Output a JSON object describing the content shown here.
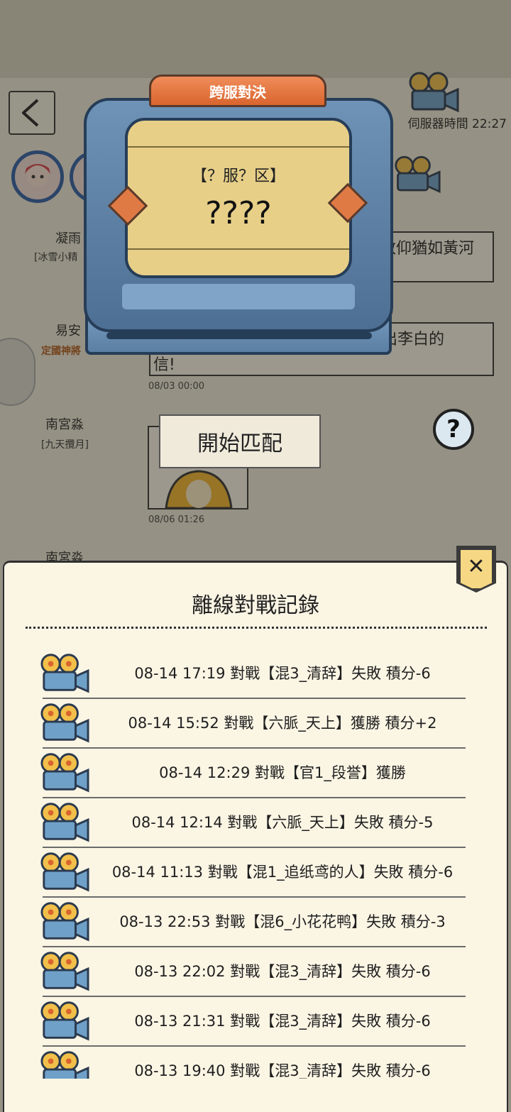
{
  "colors": {
    "accent_orange": "#d9652e",
    "tv_blue": "#4d6f93",
    "screen_yellow": "#e7cf88",
    "modal_bg": "#fbf5e4",
    "close_yellow": "#f6d884"
  },
  "header": {
    "server_time": "伺服器時間 22:27"
  },
  "background_chat": {
    "users": [
      {
        "name": "凝雨",
        "tag": "[冰雪小精"
      },
      {
        "name": "易安",
        "badge": "定國神將"
      },
      {
        "name": "南宮淼",
        "tag": "[九天攬月]"
      },
      {
        "name": "南宮淼"
      }
    ],
    "bubbles": [
      {
        "text": "敬仰猶如黃河"
      },
      {
        "text": "出李白的"
      },
      {
        "text": "信!"
      }
    ],
    "timestamps": [
      "08/03 00:00",
      "08/06 01:26"
    ]
  },
  "tv": {
    "title": "跨服對決",
    "region": "【？服？区】",
    "opponent": "????"
  },
  "buttons": {
    "start_match": "開始匹配",
    "help": "?",
    "close": "✕"
  },
  "modal": {
    "title": "離線對戰記錄",
    "records": [
      {
        "text": "08-14 17:19 對戰【混3_清辞】失敗 積分-6",
        "icon": "film-camera-icon"
      },
      {
        "text": "08-14 15:52 對戰【六脈_天上】獲勝 積分+2",
        "icon": "film-camera-icon"
      },
      {
        "text": "08-14 12:29 對戰【官1_段誉】獲勝",
        "icon": "film-camera-icon"
      },
      {
        "text": "08-14 12:14 對戰【六脈_天上】失敗 積分-5",
        "icon": "film-camera-icon"
      },
      {
        "text": "08-14 11:13 對戰【混1_追纸鸢的人】失敗 積分-6",
        "icon": "film-camera-icon"
      },
      {
        "text": "08-13 22:53 對戰【混6_小花花鸭】失敗 積分-3",
        "icon": "film-camera-icon"
      },
      {
        "text": "08-13 22:02 對戰【混3_清辞】失敗 積分-6",
        "icon": "film-camera-icon"
      },
      {
        "text": "08-13 21:31 對戰【混3_清辞】失敗 積分-6",
        "icon": "film-camera-icon"
      },
      {
        "text": "08-13 19:40 對戰【混3_清辞】失敗 積分-6",
        "icon": "film-camera-icon"
      }
    ]
  }
}
